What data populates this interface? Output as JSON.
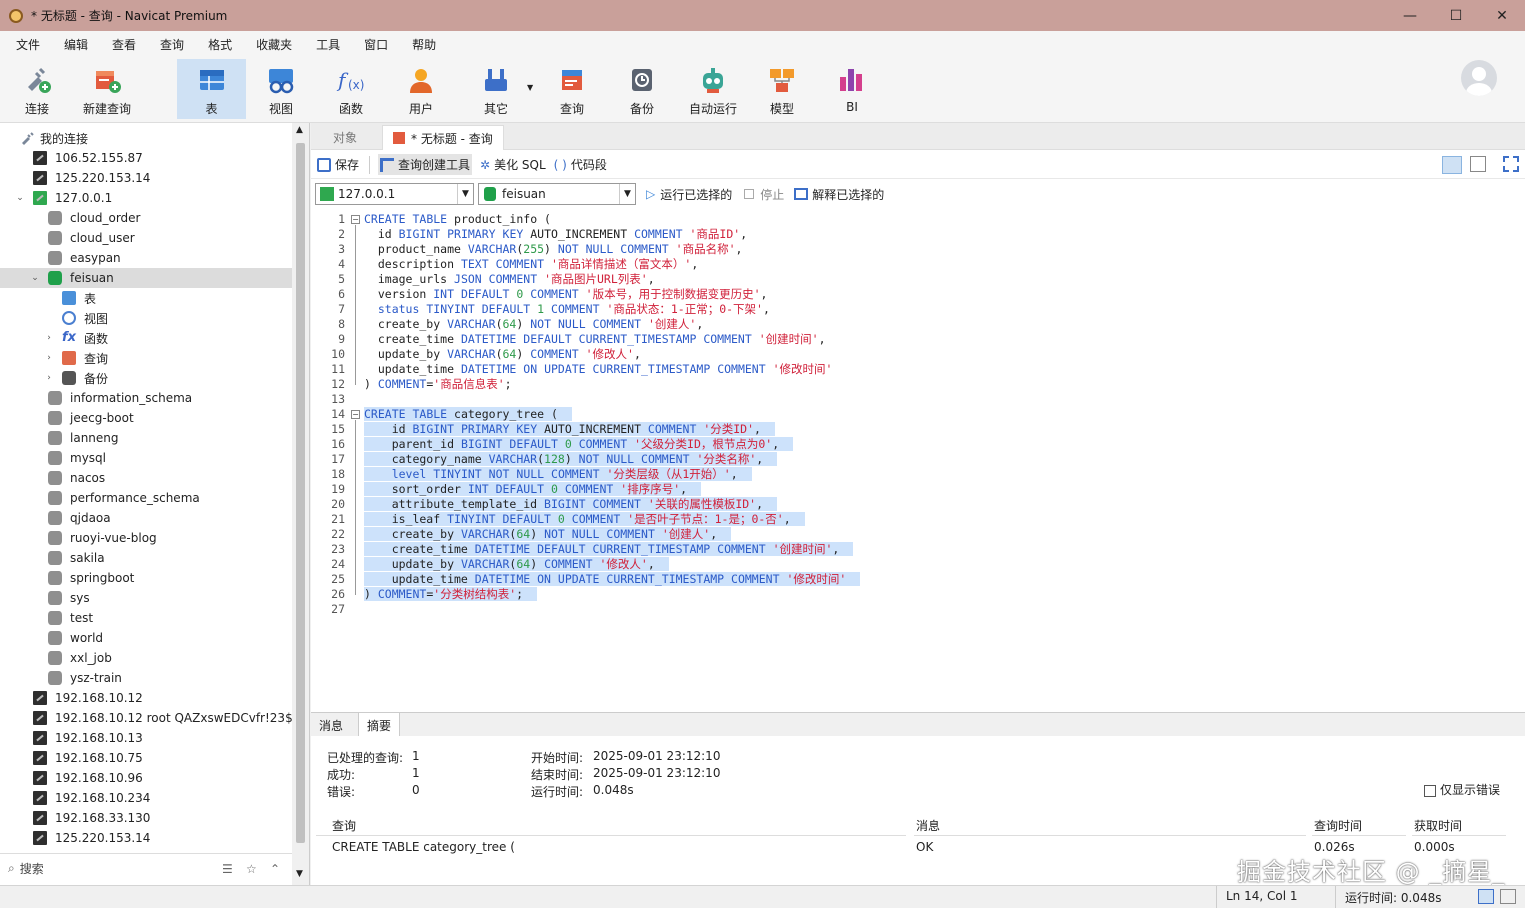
{
  "window": {
    "title": "* 无标题 - 查询 - Navicat Premium",
    "min": "—",
    "max": "☐",
    "close": "✕"
  },
  "menu": [
    "文件",
    "编辑",
    "查看",
    "查询",
    "格式",
    "收藏夹",
    "工具",
    "窗口",
    "帮助"
  ],
  "toolbar": [
    "连接",
    "新建查询",
    "表",
    "视图",
    "函数",
    "用户",
    "其它",
    "查询",
    "备份",
    "自动运行",
    "模型",
    "BI"
  ],
  "sidebar": {
    "root": "我的连接",
    "search_placeholder": "搜索",
    "nodes": [
      {
        "label": "106.52.155.87"
      },
      {
        "label": "125.220.153.14"
      },
      {
        "label": "127.0.0.1"
      },
      {
        "label": "cloud_order"
      },
      {
        "label": "cloud_user"
      },
      {
        "label": "easypan"
      },
      {
        "label": "feisuan"
      },
      {
        "label": "表"
      },
      {
        "label": "视图"
      },
      {
        "label": "函数"
      },
      {
        "label": "查询"
      },
      {
        "label": "备份"
      },
      {
        "label": "information_schema"
      },
      {
        "label": "jeecg-boot"
      },
      {
        "label": "lanneng"
      },
      {
        "label": "mysql"
      },
      {
        "label": "nacos"
      },
      {
        "label": "performance_schema"
      },
      {
        "label": "qjdaoa"
      },
      {
        "label": "ruoyi-vue-blog"
      },
      {
        "label": "sakila"
      },
      {
        "label": "springboot"
      },
      {
        "label": "sys"
      },
      {
        "label": "test"
      },
      {
        "label": "world"
      },
      {
        "label": "xxl_job"
      },
      {
        "label": "ysz-train"
      },
      {
        "label": "192.168.10.12"
      },
      {
        "label": "192.168.10.12 root QAZxswEDCvfr!23$"
      },
      {
        "label": "192.168.10.13"
      },
      {
        "label": "192.168.10.75"
      },
      {
        "label": "192.168.10.96"
      },
      {
        "label": "192.168.10.234"
      },
      {
        "label": "192.168.33.130"
      },
      {
        "label": "125.220.153.14"
      }
    ]
  },
  "tabs": {
    "objects": "对象",
    "query": "* 无标题 - 查询"
  },
  "query_toolbar": {
    "save": "保存",
    "builder": "查询创建工具",
    "beautify": "美化 SQL",
    "snippet": "代码段"
  },
  "selectors": {
    "connection": "127.0.0.1",
    "database": "feisuan",
    "run_selected": "运行已选择的",
    "stop": "停止",
    "explain_selected": "解释已选择的"
  },
  "code_lines": [
    "CREATE TABLE product_info (",
    "  id BIGINT PRIMARY KEY AUTO_INCREMENT COMMENT '商品ID',",
    "  product_name VARCHAR(255) NOT NULL COMMENT '商品名称',",
    "  description TEXT COMMENT '商品详情描述（富文本）',",
    "  image_urls JSON COMMENT '商品图片URL列表',",
    "  version INT DEFAULT 0 COMMENT '版本号，用于控制数据变更历史',",
    "  status TINYINT DEFAULT 1 COMMENT '商品状态：1-正常；0-下架',",
    "  create_by VARCHAR(64) NOT NULL COMMENT '创建人',",
    "  create_time DATETIME DEFAULT CURRENT_TIMESTAMP COMMENT '创建时间',",
    "  update_by VARCHAR(64) COMMENT '修改人',",
    "  update_time DATETIME ON UPDATE CURRENT_TIMESTAMP COMMENT '修改时间'",
    ") COMMENT='商品信息表';",
    "",
    "CREATE TABLE category_tree (",
    "    id BIGINT PRIMARY KEY AUTO_INCREMENT COMMENT '分类ID',",
    "    parent_id BIGINT DEFAULT 0 COMMENT '父级分类ID，根节点为0',",
    "    category_name VARCHAR(128) NOT NULL COMMENT '分类名称',",
    "    level TINYINT NOT NULL COMMENT '分类层级（从1开始）',",
    "    sort_order INT DEFAULT 0 COMMENT '排序序号',",
    "    attribute_template_id BIGINT COMMENT '关联的属性模板ID',",
    "    is_leaf TINYINT DEFAULT 0 COMMENT '是否叶子节点：1-是；0-否',",
    "    create_by VARCHAR(64) NOT NULL COMMENT '创建人',",
    "    create_time DATETIME DEFAULT CURRENT_TIMESTAMP COMMENT '创建时间',",
    "    update_by VARCHAR(64) COMMENT '修改人',",
    "    update_time DATETIME ON UPDATE CURRENT_TIMESTAMP COMMENT '修改时间'",
    ") COMMENT='分类树结构表';",
    ""
  ],
  "results": {
    "tabs": [
      "消息",
      "摘要"
    ],
    "processed_label": "已处理的查询:",
    "processed": "1",
    "success_label": "成功:",
    "success": "1",
    "error_label": "错误:",
    "error": "0",
    "start_label": "开始时间:",
    "start": "2025-09-01 23:12:10",
    "end_label": "结束时间:",
    "end": "2025-09-01 23:12:10",
    "runtime_label": "运行时间:",
    "runtime": "0.048s",
    "only_errors": "仅显示错误",
    "headers": [
      "查询",
      "消息",
      "查询时间",
      "获取时间"
    ],
    "row": [
      "CREATE TABLE category_tree (",
      "OK",
      "0.026s",
      "0.000s"
    ]
  },
  "status": {
    "cursor": "Ln 14, Col 1",
    "runtime": "运行时间: 0.048s"
  },
  "watermark": "掘金技术社区 @ _摘星_"
}
